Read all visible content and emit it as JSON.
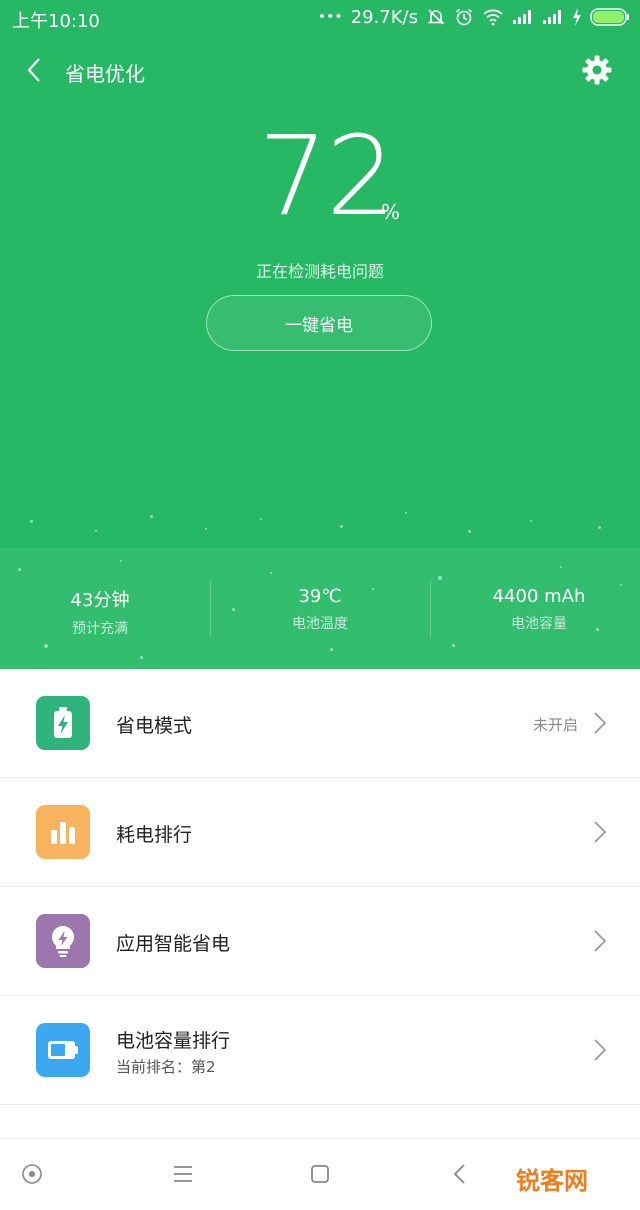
{
  "status_bar": {
    "time": "上午10:10",
    "dots": "•••",
    "net_speed": "29.7K/s"
  },
  "header": {
    "title": "省电优化",
    "back_icon": "chevron-left-icon",
    "settings_icon": "gear-icon"
  },
  "hero": {
    "battery_percent": "72",
    "unit": "%",
    "status_text": "正在检测耗电问题",
    "action_label": "一键省电",
    "bg_color": "#26b864"
  },
  "stats": [
    {
      "value": "43分钟",
      "label": "预计充满"
    },
    {
      "value": "39℃",
      "label": "电池温度"
    },
    {
      "value": "4400 mAh",
      "label": "电池容量"
    }
  ],
  "menu": [
    {
      "title": "省电模式",
      "status": "未开启",
      "icon": "battery-bolt-icon",
      "color": "#2fb47d"
    },
    {
      "title": "耗电排行",
      "icon": "bar-chart-icon",
      "color": "#f8b35f"
    },
    {
      "title": "应用智能省电",
      "icon": "lightbulb-bolt-icon",
      "color": "#9b77ae"
    },
    {
      "title": "电池容量排行",
      "subtitle": "当前排名：第2",
      "icon": "battery-icon",
      "color": "#3ca8f1"
    }
  ],
  "nav": [
    "circle-dot-icon",
    "menu-icon",
    "home-square-icon",
    "back-triangle-icon"
  ],
  "watermark": "锐客网"
}
